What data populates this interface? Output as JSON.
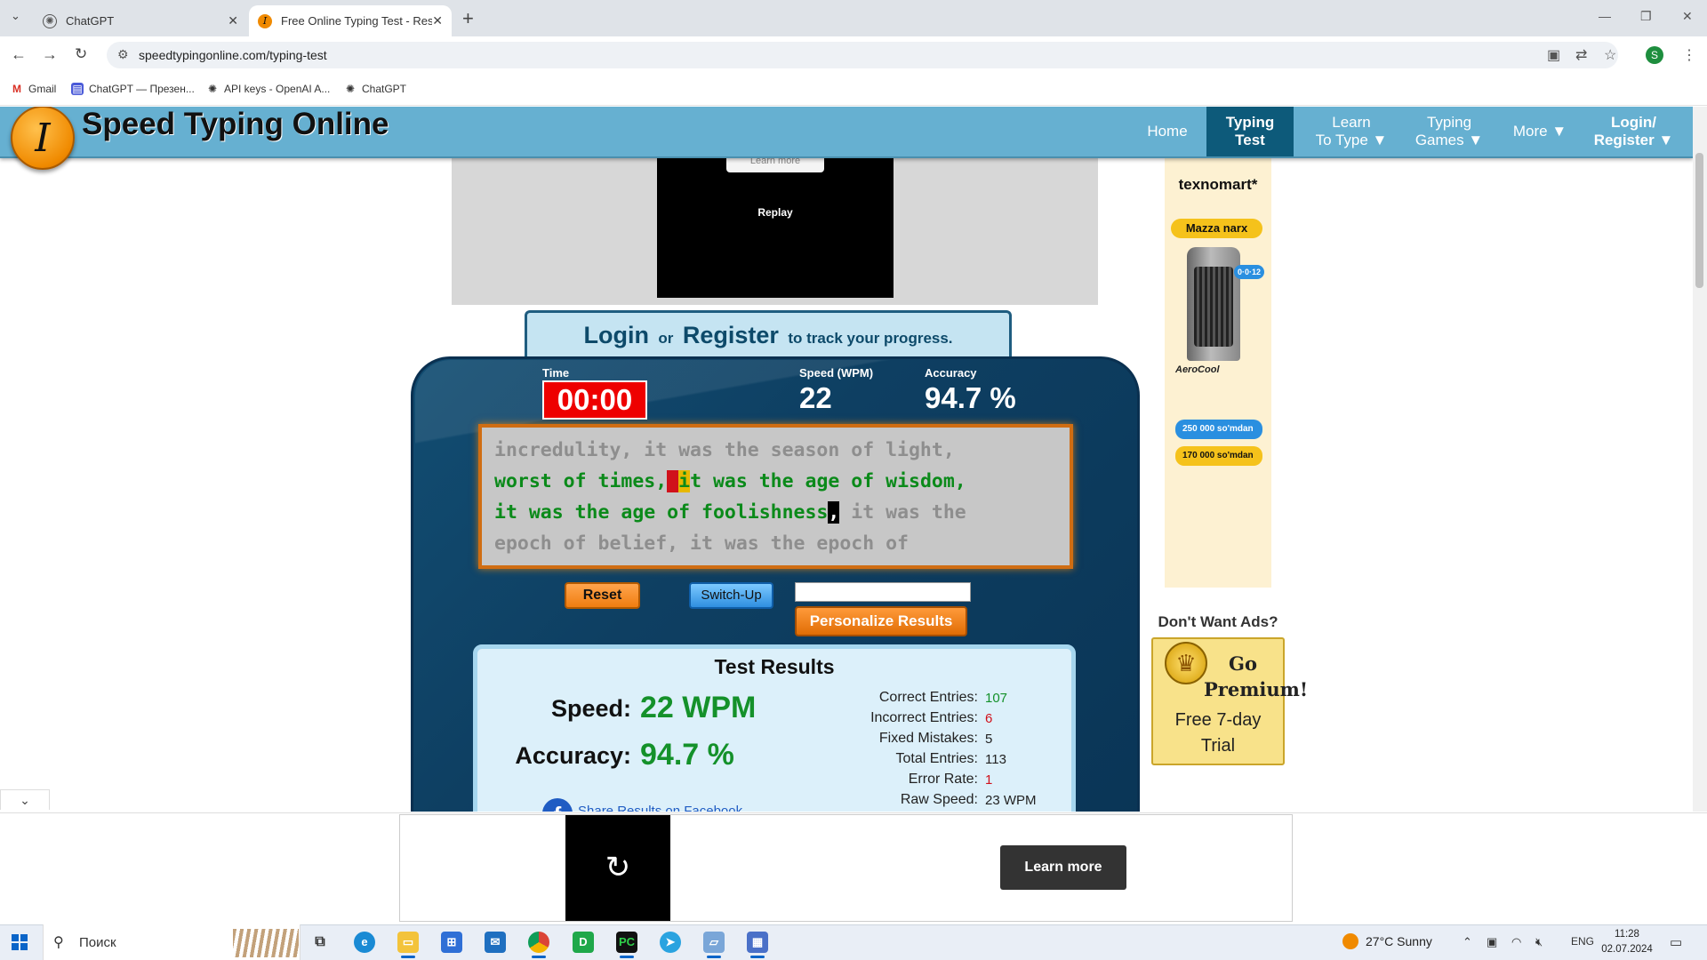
{
  "browser": {
    "tabs": [
      {
        "title": "ChatGPT",
        "icon": "chatgpt-icon",
        "active": false
      },
      {
        "title": "Free Online Typing Test - Result",
        "icon": "speedtyping-favicon",
        "active": true
      }
    ],
    "url": "speedtypingonline.com/typing-test",
    "profile_initial": "S",
    "bookmarks": [
      {
        "label": "Gmail",
        "icon": "gmail-icon"
      },
      {
        "label": "ChatGPT — Презен...",
        "icon": "presentation-icon"
      },
      {
        "label": "API keys - OpenAI A...",
        "icon": "openai-icon"
      },
      {
        "label": "ChatGPT",
        "icon": "chatgpt-icon"
      }
    ]
  },
  "site": {
    "logo_letter": "I",
    "logo_text": "Speed Typing Online",
    "nav": [
      {
        "line1": "Home",
        "line2": ""
      },
      {
        "line1": "Typing",
        "line2": "Test"
      },
      {
        "line1": "Learn",
        "line2": "To Type ▼"
      },
      {
        "line1": "Typing",
        "line2": "Games ▼"
      },
      {
        "line1": "More ▼",
        "line2": ""
      },
      {
        "line1": "Login/",
        "line2": "Register ▼"
      }
    ],
    "active_nav": "Typing Test"
  },
  "top_ad": {
    "learn_more": "Learn more",
    "replay": "Replay"
  },
  "login_banner": {
    "login": "Login",
    "or": "or",
    "register": "Register",
    "suffix": "to track your progress."
  },
  "stats": {
    "time_label": "Time",
    "time_value": "00:00",
    "speed_label": "Speed (WPM)",
    "speed_value": "22",
    "accuracy_label": "Accuracy",
    "accuracy_value": "94.7 %"
  },
  "typing_text": {
    "line1": "incredulity, it was the season of light,",
    "line2_typed": "worst of times,",
    "line2_err": " ",
    "line2_cur": "i",
    "line2_rest": "t was the age of wisdom,",
    "line3_typed": "it was the age of foolishness",
    "line3_caret": ",",
    "line3_rest": " it was the",
    "line4": "epoch of belief, it was the epoch of"
  },
  "controls": {
    "reset": "Reset",
    "switch_up": "Switch-Up",
    "name_value": "",
    "personalize": "Personalize Results"
  },
  "results": {
    "title": "Test Results",
    "speed_label": "Speed:",
    "speed_value": "22 WPM",
    "accuracy_label": "Accuracy:",
    "accuracy_value": "94.7 %",
    "details": [
      {
        "label": "Correct Entries:",
        "value": "107",
        "color": "#14912a"
      },
      {
        "label": "Incorrect Entries:",
        "value": "6",
        "color": "#d0111b"
      },
      {
        "label": "Fixed Mistakes:",
        "value": "5",
        "color": "#222222"
      },
      {
        "label": "Total Entries:",
        "value": "113",
        "color": "#222222"
      },
      {
        "label": "Error Rate:",
        "value": "1",
        "color": "#d0111b"
      },
      {
        "label": "Raw Speed:",
        "value": "23 WPM",
        "color": "#222222"
      }
    ],
    "share": "Share Results on Facebook"
  },
  "side_ad": {
    "brand": "texnomart*",
    "badge": "Mazza narx",
    "product_tag": "0·0·12",
    "product_brand": "AeroCool",
    "price1": "250 000 so'mdan",
    "price2": "170 000 so'mdan"
  },
  "premium": {
    "noads": "Don't Want Ads?",
    "title": "Go Premium!",
    "sub": "Free 7-day Trial"
  },
  "bottom_ad": {
    "learn_more": "Learn more",
    "replay_icon": "↻"
  },
  "taskbar": {
    "search_placeholder": "Поиск",
    "weather": "27°C  Sunny",
    "lang": "ENG",
    "time": "11:28",
    "date": "02.07.2024"
  }
}
